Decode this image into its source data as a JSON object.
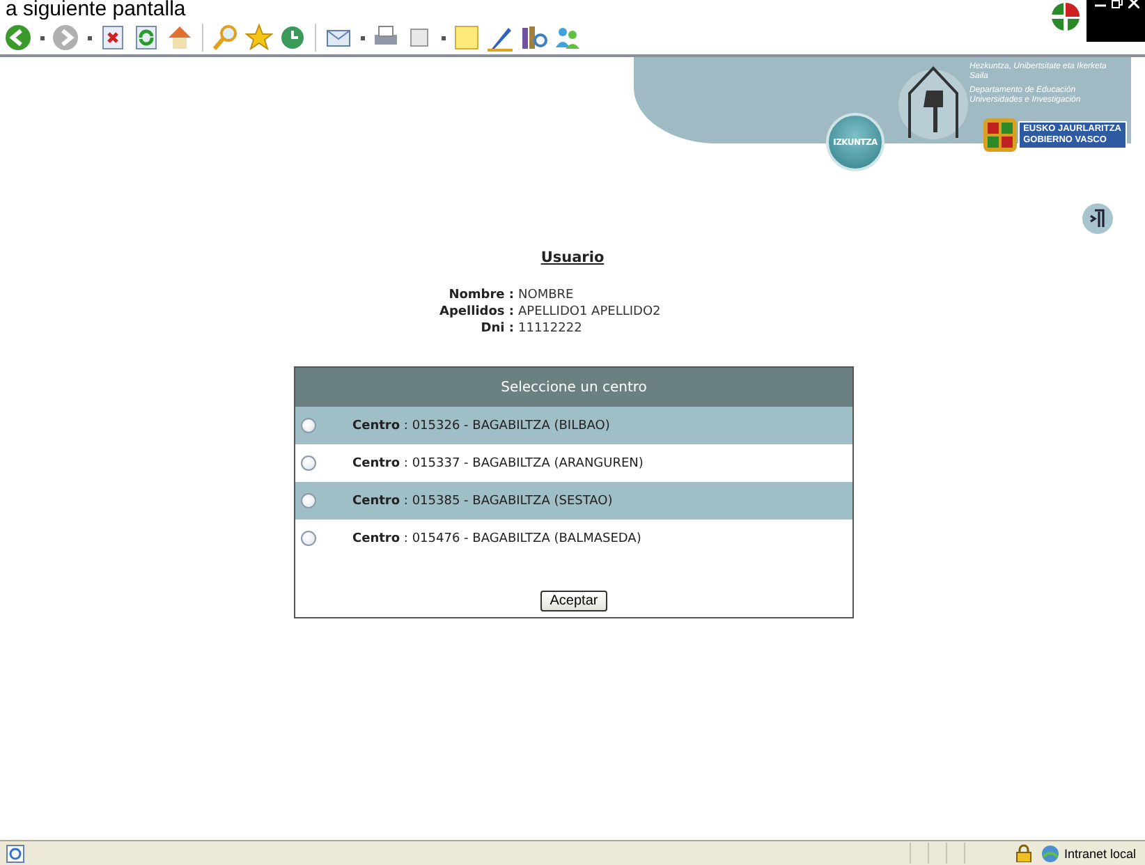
{
  "caption": "a siguiente pantalla",
  "toolbar": {
    "buttons": [
      {
        "kind": "back"
      },
      {
        "kind": "dropdown"
      },
      {
        "kind": "forward"
      },
      {
        "kind": "dropdown"
      },
      {
        "kind": "stop"
      },
      {
        "kind": "refresh"
      },
      {
        "kind": "home"
      },
      {
        "kind": "sep"
      },
      {
        "kind": "search"
      },
      {
        "kind": "star"
      },
      {
        "kind": "history"
      },
      {
        "kind": "sep"
      },
      {
        "kind": "mail"
      },
      {
        "kind": "dropdown"
      },
      {
        "kind": "print"
      },
      {
        "kind": "frame"
      },
      {
        "kind": "dropdown"
      },
      {
        "kind": "note"
      },
      {
        "kind": "pen"
      },
      {
        "kind": "books"
      },
      {
        "kind": "people"
      }
    ]
  },
  "banner": {
    "badge": "IZKUNTZA",
    "dept_eu": "Hezkuntza, Unibertsitate eta Ikerketa Saila",
    "dept_es": "Departamento de Educación Universidades e Investigación",
    "gov_eu": "EUSKO JAURLARITZA",
    "gov_es": "GOBIERNO VASCO"
  },
  "user": {
    "title": "Usuario",
    "fields": [
      {
        "label": "Nombre :",
        "value": "NOMBRE"
      },
      {
        "label": "Apellidos :",
        "value": "APELLIDO1 APELLIDO2"
      },
      {
        "label": "Dni :",
        "value": "11112222"
      }
    ]
  },
  "centers": {
    "title": "Seleccione un centro",
    "options": [
      {
        "label": "Centro",
        "value": ": 015326 - BAGABILTZA (BILBAO)",
        "selected": false
      },
      {
        "label": "Centro",
        "value": ": 015337 - BAGABILTZA (ARANGUREN)",
        "selected": false
      },
      {
        "label": "Centro",
        "value": ": 015385 - BAGABILTZA (SESTAO)",
        "selected": false
      },
      {
        "label": "Centro",
        "value": ": 015476 - BAGABILTZA (BALMASEDA)",
        "selected": false
      }
    ],
    "button": "Aceptar"
  },
  "status_bar": {
    "zone": "Intranet local"
  }
}
